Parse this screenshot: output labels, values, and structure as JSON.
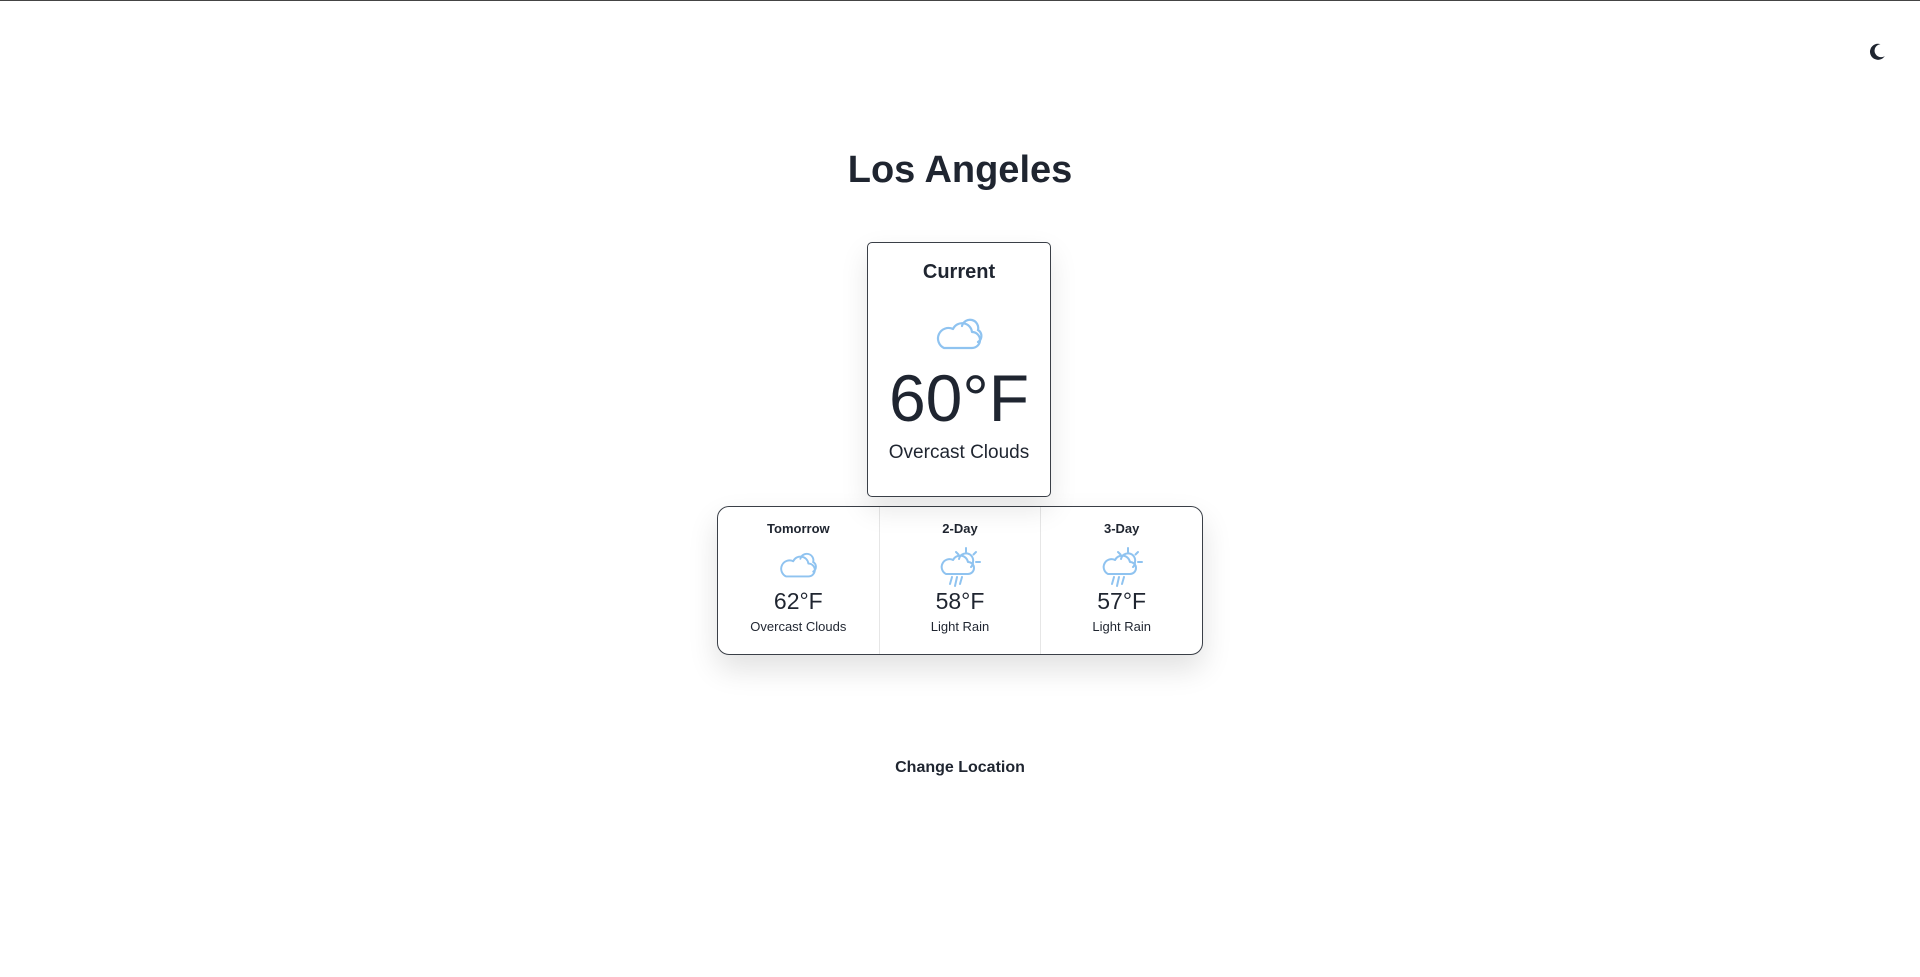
{
  "header": {
    "theme_toggle_icon": "moon-icon"
  },
  "city": "Los Angeles",
  "current": {
    "label": "Current",
    "icon": "cloud-icon",
    "temperature": "60°F",
    "description": "Overcast Clouds"
  },
  "forecast": [
    {
      "label": "Tomorrow",
      "icon": "cloud-icon",
      "temperature": "62°F",
      "description": "Overcast Clouds"
    },
    {
      "label": "2-Day",
      "icon": "sun-rain-icon",
      "temperature": "58°F",
      "description": "Light Rain"
    },
    {
      "label": "3-Day",
      "icon": "sun-rain-icon",
      "temperature": "57°F",
      "description": "Light Rain"
    }
  ],
  "actions": {
    "change_location": "Change Location"
  },
  "colors": {
    "icon_blue": "#8fc3f0",
    "text": "#1f2530"
  }
}
